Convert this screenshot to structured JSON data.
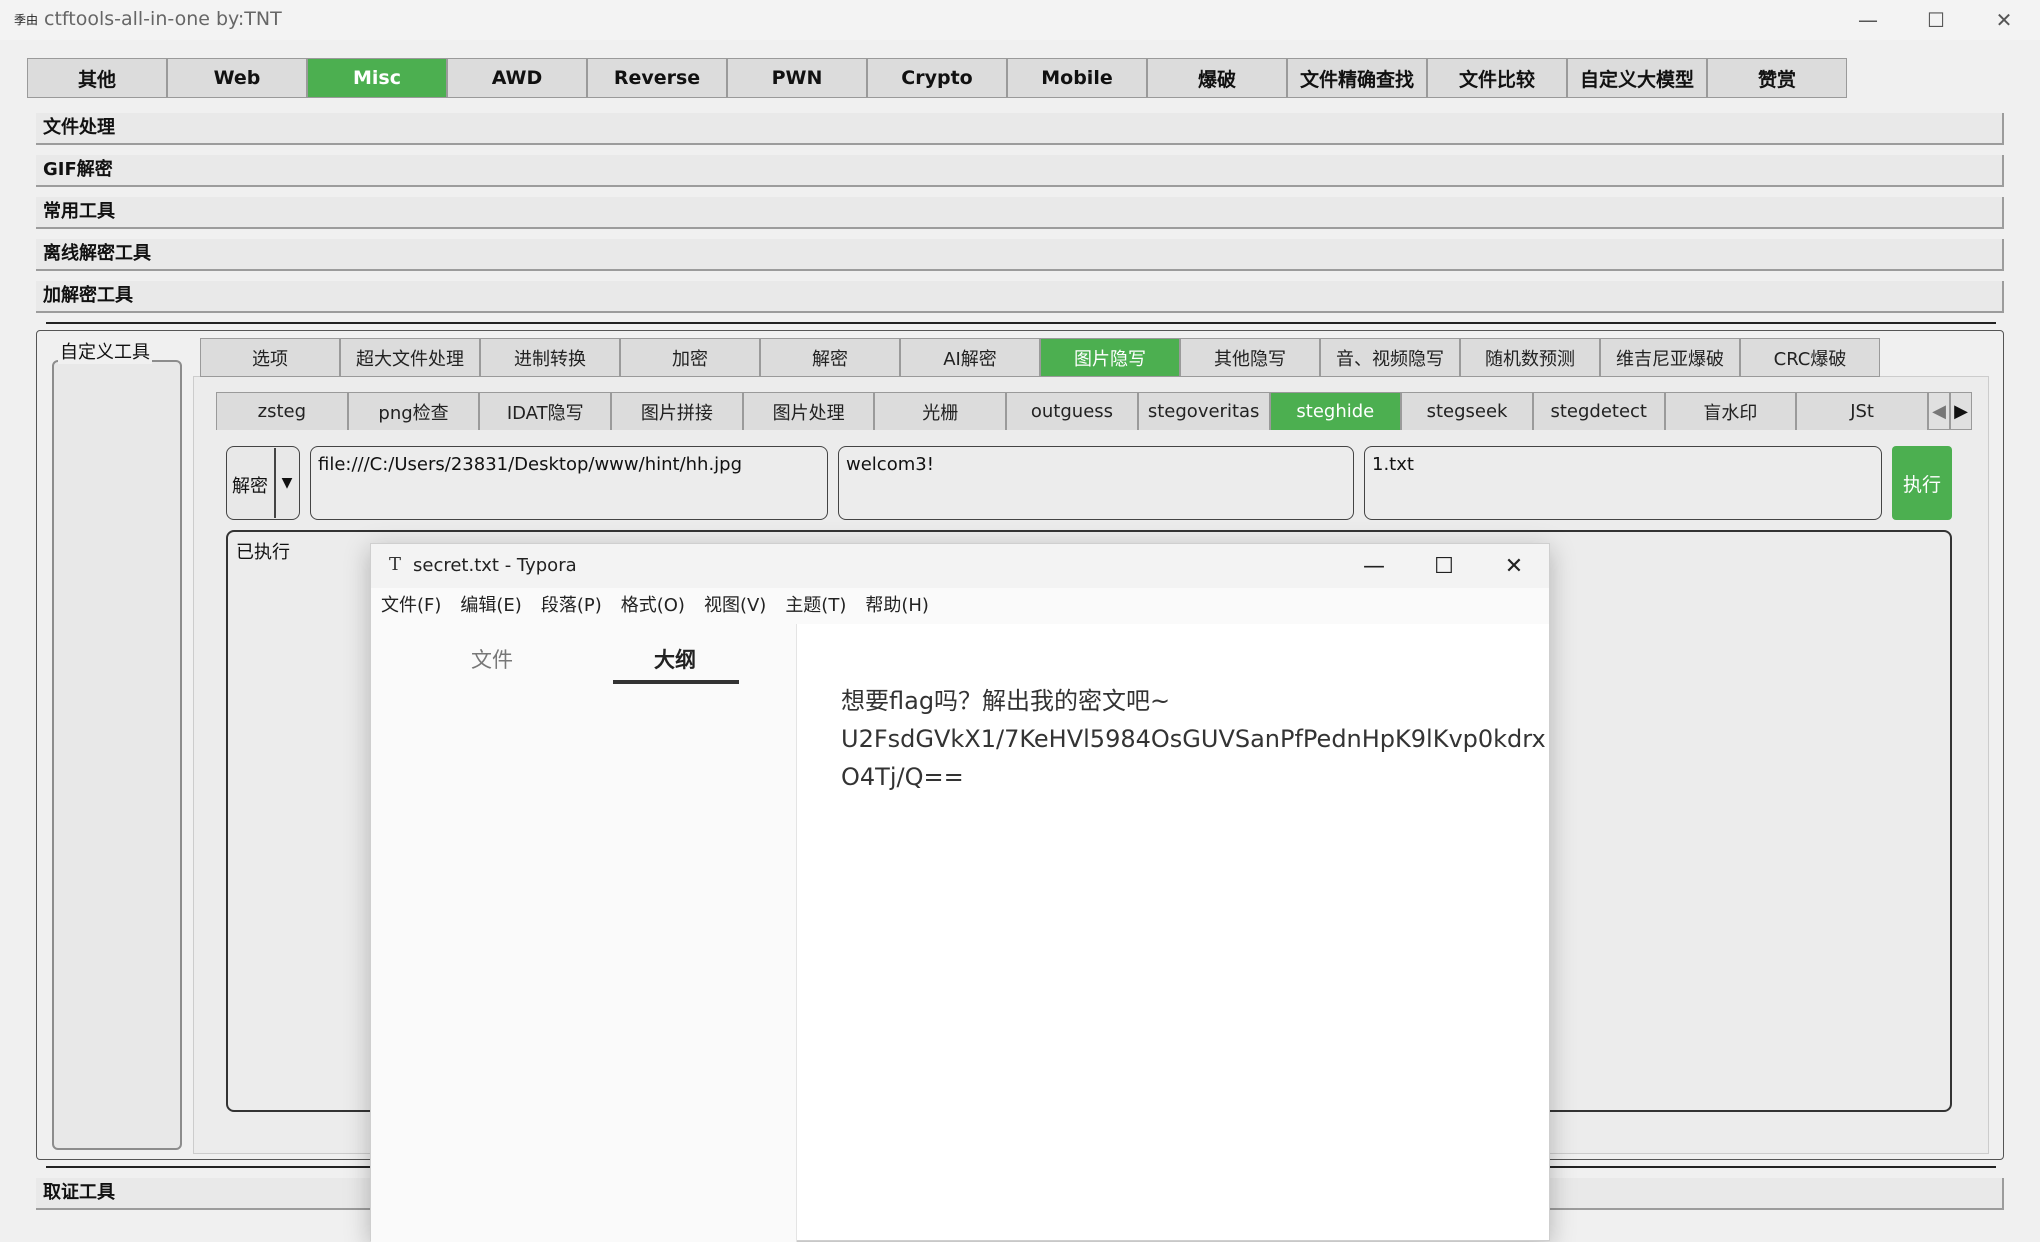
{
  "app": {
    "icon_text": "季由",
    "title": "ctftools-all-in-one   by:TNT",
    "win_controls": [
      "—",
      "☐",
      "✕"
    ]
  },
  "main_tabs": [
    {
      "label": "其他"
    },
    {
      "label": "Web"
    },
    {
      "label": "Misc",
      "active": true
    },
    {
      "label": "AWD"
    },
    {
      "label": "Reverse"
    },
    {
      "label": "PWN"
    },
    {
      "label": "Crypto"
    },
    {
      "label": "Mobile"
    },
    {
      "label": "爆破"
    },
    {
      "label": "文件精确查找"
    },
    {
      "label": "文件比较"
    },
    {
      "label": "自定义大模型"
    },
    {
      "label": "赞赏"
    }
  ],
  "sections": [
    "文件处理",
    "GIF解密",
    "常用工具",
    "离线解密工具",
    "加解密工具"
  ],
  "custom_tools_label": "自定义工具",
  "sub_tabs": [
    {
      "label": "选项"
    },
    {
      "label": "超大文件处理"
    },
    {
      "label": "进制转换"
    },
    {
      "label": "加密"
    },
    {
      "label": "解密"
    },
    {
      "label": "AI解密"
    },
    {
      "label": "图片隐写",
      "active": true
    },
    {
      "label": "其他隐写"
    },
    {
      "label": "音、视频隐写"
    },
    {
      "label": "随机数预测"
    },
    {
      "label": "维吉尼亚爆破"
    },
    {
      "label": "CRC爆破"
    }
  ],
  "tool_tabs": [
    {
      "label": "zsteg"
    },
    {
      "label": "png检查"
    },
    {
      "label": "IDAT隐写"
    },
    {
      "label": "图片拼接"
    },
    {
      "label": "图片处理"
    },
    {
      "label": "光栅"
    },
    {
      "label": "outguess"
    },
    {
      "label": "stegoveritas"
    },
    {
      "label": "steghide",
      "active": true
    },
    {
      "label": "stegseek"
    },
    {
      "label": "stegdetect"
    },
    {
      "label": "盲水印"
    },
    {
      "label": "JSt"
    }
  ],
  "form": {
    "mode": "解密",
    "file_path": "file:///C:/Users/23831/Desktop/www/hint/hh.jpg",
    "password": "welcom3!",
    "output_file": "1.txt",
    "exec_label": "执行"
  },
  "output_text": "已执行",
  "bottom_section": "取证工具",
  "typora": {
    "title": "secret.txt - Typora",
    "menu": [
      "文件(F)",
      "编辑(E)",
      "段落(P)",
      "格式(O)",
      "视图(V)",
      "主题(T)",
      "帮助(H)"
    ],
    "sidebar_tabs": [
      "文件",
      "大纲"
    ],
    "content_lines": [
      "想要flag吗？解出我的密文吧~",
      "U2FsdGVkX1/7KeHVl5984OsGUVSanPfPednHpK9lKvp0kdrx",
      "O4Tj/Q=="
    ]
  }
}
